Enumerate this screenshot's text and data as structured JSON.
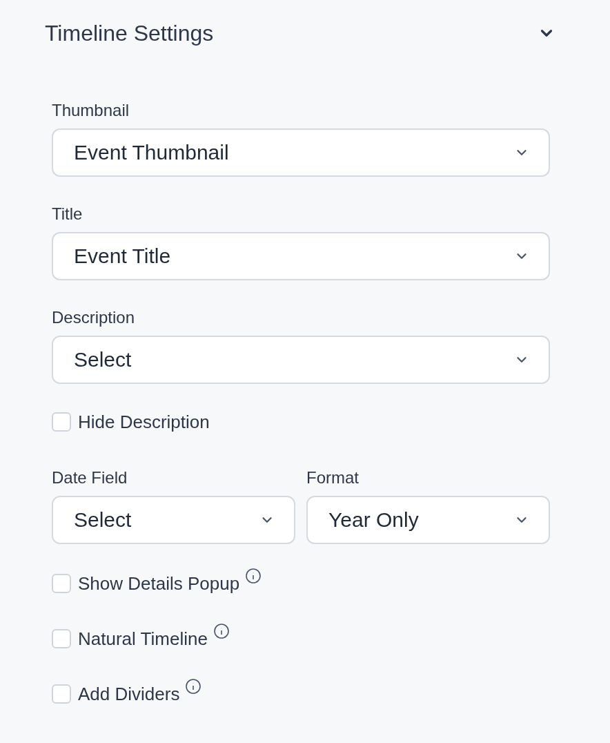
{
  "panel": {
    "title": "Timeline Settings",
    "expanded": true
  },
  "fields": [
    {
      "kind": "select",
      "label": "Thumbnail",
      "value": "Event Thumbnail"
    },
    {
      "kind": "select",
      "label": "Title",
      "value": "Event Title"
    },
    {
      "kind": "select",
      "label": "Description",
      "value": "Select"
    },
    {
      "kind": "checkbox",
      "label": "Hide Description",
      "checked": false,
      "info": false
    },
    {
      "kind": "pair",
      "items": [
        {
          "label": "Date Field",
          "value": "Select"
        },
        {
          "label": "Format",
          "value": "Year Only"
        }
      ]
    },
    {
      "kind": "checkbox",
      "label": "Show Details Popup",
      "checked": false,
      "info": true
    },
    {
      "kind": "checkbox",
      "label": "Natural Timeline",
      "checked": false,
      "info": true
    },
    {
      "kind": "checkbox",
      "label": "Add Dividers",
      "checked": false,
      "info": true
    }
  ]
}
